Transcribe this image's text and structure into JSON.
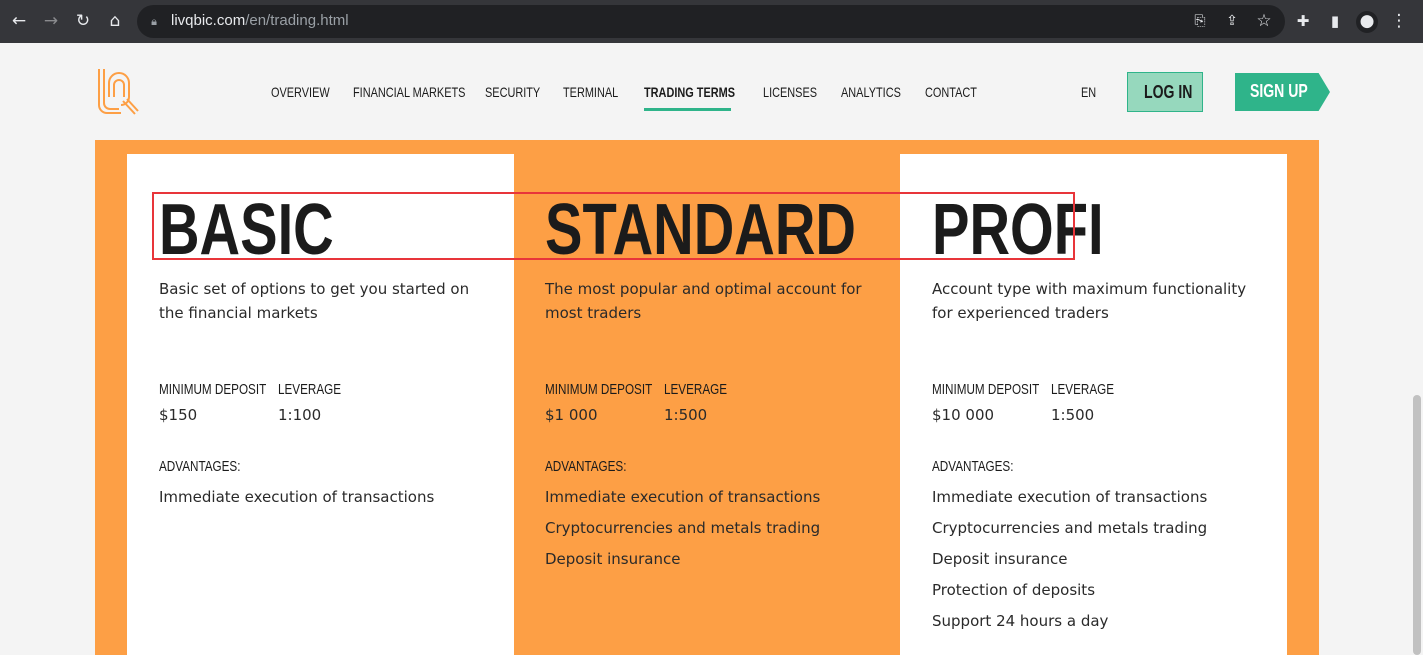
{
  "browser": {
    "url_domain": "livqbic.com",
    "url_path": "/en/trading.html"
  },
  "nav": {
    "items": [
      "OVERVIEW",
      "FINANCIAL MARKETS",
      "SECURITY",
      "TERMINAL",
      "TRADING TERMS",
      "LICENSES",
      "ANALYTICS",
      "CONTACT"
    ],
    "active": "TRADING TERMS",
    "lang": "EN",
    "login": "LOG IN",
    "signup": "SIGN UP"
  },
  "colors": {
    "accent": "#2fb48a",
    "orange": "#fd9f45",
    "highlight": "#e8353a"
  },
  "plans": [
    {
      "title": "BASIC",
      "desc": "Basic set of options to get you started on the financial markets",
      "deposit_label": "MINIMUM DEPOSIT",
      "deposit": "$150",
      "leverage_label": "LEVERAGE",
      "leverage": "1:100",
      "adv_label": "ADVANTAGES:",
      "advantages": [
        "Immediate execution of transactions"
      ]
    },
    {
      "title": "STANDARD",
      "desc": "The most popular and optimal account for most traders",
      "deposit_label": "MINIMUM DEPOSIT",
      "deposit": "$1 000",
      "leverage_label": "LEVERAGE",
      "leverage": "1:500",
      "adv_label": "ADVANTAGES:",
      "advantages": [
        "Immediate execution of transactions",
        "Cryptocurrencies and metals trading",
        "Deposit insurance"
      ]
    },
    {
      "title": "PROFI",
      "desc": "Account type with maximum functionality for experienced traders",
      "deposit_label": "MINIMUM DEPOSIT",
      "deposit": "$10 000",
      "leverage_label": "LEVERAGE",
      "leverage": "1:500",
      "adv_label": "ADVANTAGES:",
      "advantages": [
        "Immediate execution of transactions",
        "Cryptocurrencies and metals trading",
        "Deposit insurance",
        "Protection of deposits",
        "Support 24 hours a day"
      ]
    }
  ]
}
